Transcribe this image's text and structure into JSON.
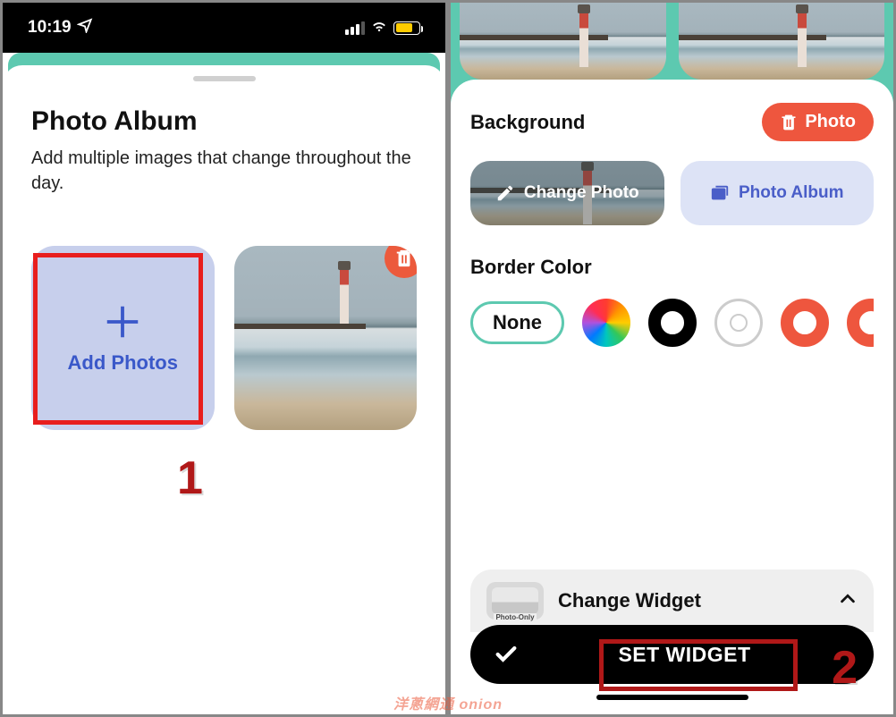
{
  "statusbar": {
    "time": "10:19"
  },
  "left": {
    "title": "Photo Album",
    "subtitle": "Add multiple images that change throughout the day.",
    "add_label": "Add Photos",
    "step_marker": "1"
  },
  "right": {
    "background_label": "Background",
    "photo_delete_label": "Photo",
    "change_photo_label": "Change Photo",
    "photo_album_label": "Photo Album",
    "border_color_label": "Border Color",
    "none_label": "None",
    "swatches": [
      "rainbow",
      "black",
      "white",
      "coral",
      "coral"
    ],
    "change_widget_label": "Change Widget",
    "mini_widget_caption": "Photo-Only",
    "set_widget_label": "SET WIDGET",
    "step_marker": "2"
  },
  "watermark": "洋蔥網通 onion"
}
